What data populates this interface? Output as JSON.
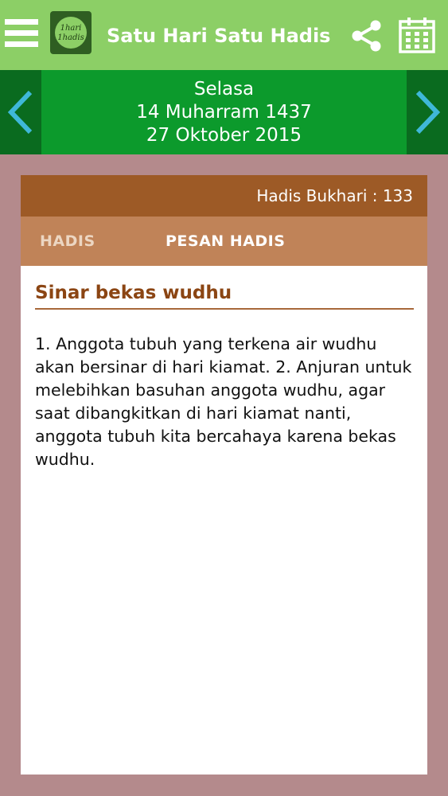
{
  "app": {
    "title": "Satu Hari Satu Hadis",
    "logo_text_top": "1hari",
    "logo_text_bottom": "1hadis"
  },
  "icons": {
    "menu": "hamburger-menu-icon",
    "share": "share-icon",
    "calendar": "calendar-icon",
    "prev": "chevron-left-icon",
    "next": "chevron-right-icon"
  },
  "date": {
    "day": "Selasa",
    "hijri": "14 Muharram 1437",
    "gregorian": "27 Oktober 2015"
  },
  "card": {
    "reference": "Hadis Bukhari : 133",
    "tabs": [
      {
        "label": "HADIS",
        "active": false
      },
      {
        "label": "PESAN HADIS",
        "active": true
      }
    ],
    "title": "Sinar bekas wudhu",
    "body": "1. Anggota tubuh yang terkena air wudhu akan bersinar di hari kiamat. 2. Anjuran untuk melebihkan basuhan anggota wudhu, agar saat dibangkitkan di hari kiamat nanti, anggota tubuh kita bercahaya karena bekas wudhu."
  },
  "colors": {
    "topbar": "#8ccf66",
    "datebar": "#0c9a2c",
    "nav": "#0a6b1f",
    "chevron": "#3fb8d8",
    "card_header": "#9d5a26",
    "tabs": "#c08358",
    "title": "#8b4513",
    "background": "#b48a8c"
  }
}
